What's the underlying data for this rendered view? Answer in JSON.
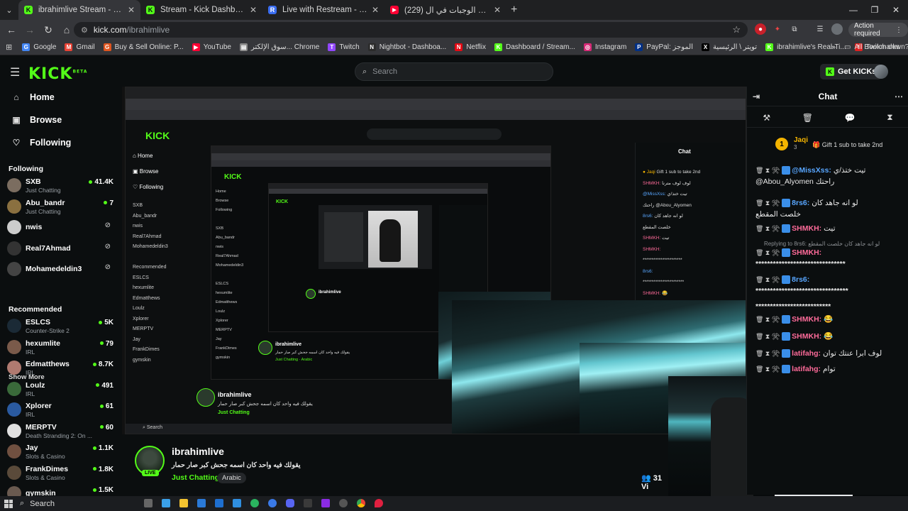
{
  "browser": {
    "tabs": [
      {
        "title": "ibrahimlive Stream - Watch Live",
        "color": "#53fc18",
        "letter": "K",
        "active": true
      },
      {
        "title": "Stream - Kick Dashboard",
        "color": "#53fc18",
        "letter": "K",
        "active": false
      },
      {
        "title": "Live with Restream - Restream",
        "color": "#3a6df0",
        "letter": "R",
        "active": false
      },
      {
        "title": "(229) جربت ارخص الوجبات في ال",
        "color": "#ff0033",
        "letter": "▶",
        "active": false
      }
    ],
    "url_host": "kick.com",
    "url_path": "/ibrahimlive",
    "action_required": "Action required",
    "bookmarks": [
      {
        "label": "Google",
        "color": "#4285f4",
        "letter": "G"
      },
      {
        "label": "Gmail",
        "color": "#ea4335",
        "letter": "M"
      },
      {
        "label": "Buy & Sell Online: P...",
        "color": "#e0551f",
        "letter": "G"
      },
      {
        "label": "YouTube",
        "color": "#ff0033",
        "letter": "▶"
      },
      {
        "label": "سوق الإلكتر... Chrome",
        "color": "#888888",
        "letter": "▤"
      },
      {
        "label": "Twitch",
        "color": "#9146ff",
        "letter": "T"
      },
      {
        "label": "Nightbot - Dashboa...",
        "color": "#2b2b2b",
        "letter": "N"
      },
      {
        "label": "Netflix",
        "color": "#e50914",
        "letter": "N"
      },
      {
        "label": "Dashboard / Stream...",
        "color": "#53fc18",
        "letter": "K"
      },
      {
        "label": "Instagram",
        "color": "#d62976",
        "letter": "◎"
      },
      {
        "label": "PayPal: الموجز",
        "color": "#003087",
        "letter": "P"
      },
      {
        "label": "تويتر \\ الرئيسية",
        "color": "#000000",
        "letter": "X"
      },
      {
        "label": "ibrahimlive's Real-Ti...",
        "color": "#53fc18",
        "letter": "K"
      },
      {
        "label": "Twitch down? Curre...",
        "color": "#e02020",
        "letter": "!"
      }
    ],
    "all_bookmarks": "All Bookmarks"
  },
  "header": {
    "logo": "KICK",
    "logo_sup": "BETA",
    "search_placeholder": "Search",
    "get_kicks": "Get KICKs"
  },
  "sidebar": {
    "nav": [
      {
        "label": "Home",
        "icon": "home-icon"
      },
      {
        "label": "Browse",
        "icon": "browse-icon"
      },
      {
        "label": "Following",
        "icon": "heart-icon"
      }
    ],
    "following_title": "Following",
    "following": [
      {
        "name": "SXB",
        "sub": "Just Chatting",
        "viewers": "41.4K",
        "color": "#7b6d60"
      },
      {
        "name": "Abu_bandr",
        "sub": "Just Chatting",
        "viewers": "7",
        "color": "#8a7040"
      },
      {
        "name": "nwis",
        "sub": "",
        "viewers": "",
        "color": "#cccccc"
      },
      {
        "name": "Real7Ahmad",
        "sub": "",
        "viewers": "",
        "color": "#333333"
      },
      {
        "name": "Mohamedeldin3",
        "sub": "",
        "viewers": "",
        "color": "#444444"
      }
    ],
    "show_more": "Show More",
    "recommended_title": "Recommended",
    "recommended": [
      {
        "name": "ESLCS",
        "sub": "Counter-Strike 2",
        "viewers": "5K",
        "color": "#1b2a36"
      },
      {
        "name": "hexumlite",
        "sub": "IRL",
        "viewers": "79",
        "color": "#7a5a4a"
      },
      {
        "name": "Edmatthews",
        "sub": "IRL",
        "viewers": "8.7K",
        "color": "#b07a70"
      },
      {
        "name": "Loulz",
        "sub": "IRL",
        "viewers": "491",
        "color": "#3a6a3a"
      },
      {
        "name": "Xplorer",
        "sub": "IRL",
        "viewers": "61",
        "color": "#2a5aa0"
      },
      {
        "name": "MERPTV",
        "sub": "Death Stranding 2: On ...",
        "viewers": "60",
        "color": "#e0e0e0"
      },
      {
        "name": "Jay",
        "sub": "Slots & Casino",
        "viewers": "1.1K",
        "color": "#705040"
      },
      {
        "name": "FrankDimes",
        "sub": "Slots & Casino",
        "viewers": "1.8K",
        "color": "#5a4a3a"
      },
      {
        "name": "gymskin",
        "sub": "",
        "viewers": "1.5K",
        "color": "#6a5a50"
      }
    ]
  },
  "stream": {
    "name": "ibrahimlive",
    "title": "يقولك فيه واحد كان اسمه جحش كبر صار حمار",
    "category": "Just Chatting",
    "language": "Arabic",
    "viewers": "31 Vi",
    "live": "LIVE"
  },
  "chat": {
    "title": "Chat",
    "gift": {
      "name": "Jaqi",
      "count": "3",
      "text": "Gift 1 sub to take 2nd"
    },
    "messages": [
      {
        "user": "@MissXss:",
        "text": "تيت ختذ/ي",
        "line2": "@Abou_Alyomen راحتك",
        "color": "#58a6ff"
      },
      {
        "user": "8rs6:",
        "text": "لو انه جاهد كان",
        "line2": "خلصت المقطع",
        "color": "#58a6ff"
      },
      {
        "user": "SHMKH:",
        "text": "تيت",
        "line2": "",
        "color": "#ff6b9a"
      },
      {
        "user": "SHMKH:",
        "text": "",
        "line2": "*******************************",
        "color": "#ff6b9a"
      },
      {
        "user": "8rs6:",
        "text": "",
        "line2": "********************************",
        "color": "#58a6ff"
      },
      {
        "user": "SHMKH:",
        "text": "😂",
        "line2": "",
        "color": "#ff6b9a"
      },
      {
        "user": "SHMKH:",
        "text": "😂",
        "line2": "",
        "color": "#ff6b9a"
      },
      {
        "user": "latifahg:",
        "text": "لوف ابرا عنتك توان",
        "line2": "",
        "color": "#ff6b9a"
      },
      {
        "user": "latifahg:",
        "text": "توام",
        "line2": "",
        "color": "#ff6b9a"
      }
    ],
    "reply_text": "Replying to 8rs6: لو انه جاهد كان خلصت المقطع",
    "extra_line": "**************************"
  },
  "taskbar": {
    "search": "Search"
  }
}
